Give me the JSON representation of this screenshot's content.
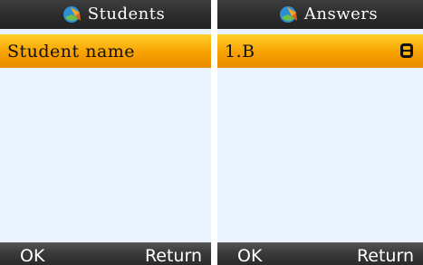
{
  "screens": [
    {
      "title": "Students",
      "title_icon": "app-logo-icon",
      "selected_row": {
        "label": "Student name"
      },
      "softkeys": {
        "left": "OK",
        "right": "Return"
      }
    },
    {
      "title": "Answers",
      "title_icon": "app-logo-icon",
      "selected_row": {
        "label": "1.B",
        "status_icon": "answer-status-icon"
      },
      "softkeys": {
        "left": "OK",
        "right": "Return"
      }
    }
  ],
  "colors": {
    "titlebar": "#2b2b2b",
    "highlight": "#f7a200",
    "list_background": "#eaf3fd",
    "softkey_bar": "#3b3b3b"
  }
}
